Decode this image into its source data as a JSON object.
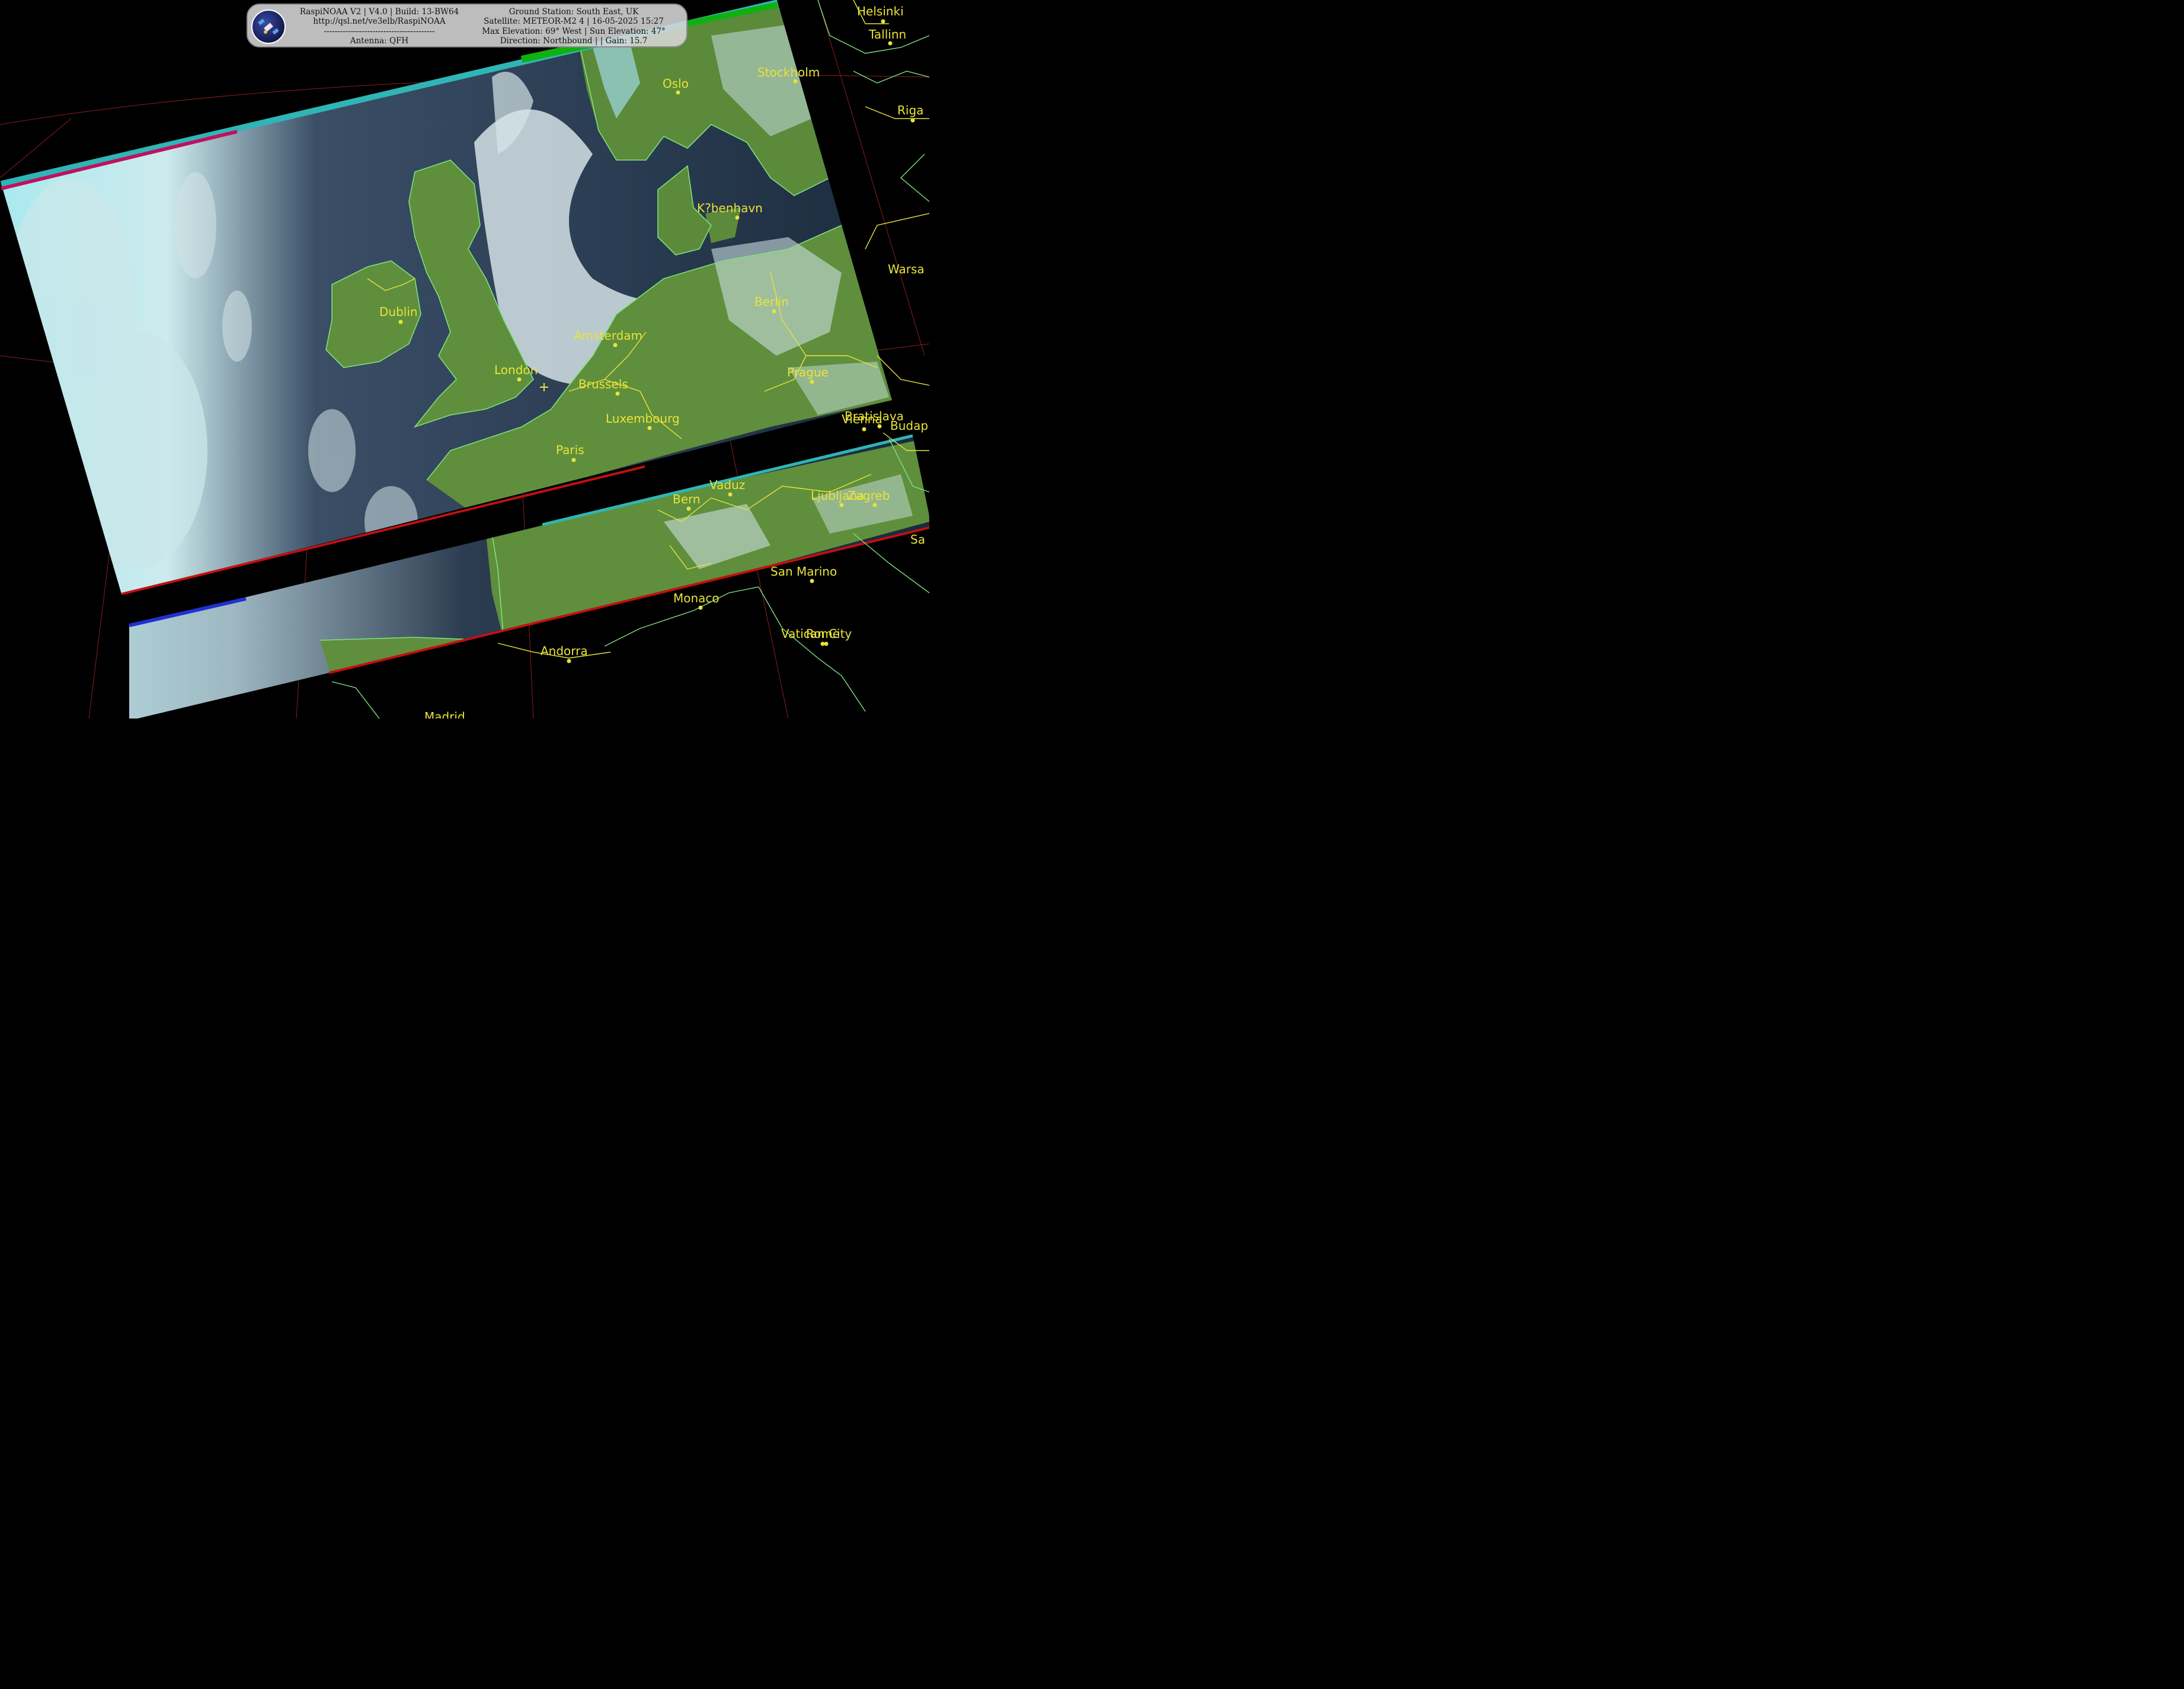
{
  "header": {
    "left_lines": [
      "RaspiNOAA V2 | V4.0 | Build: 13-BW64",
      "http://qsl.net/ve3elb/RaspiNOAA",
      "-----------------------------------------",
      "Antenna: QFH"
    ],
    "right_lines": [
      "Ground Station: South East, UK",
      "Satellite: METEOR-M2 4 | 16-05-2025 15:27",
      "Max Elevation: 69° West | Sun Elevation: 47°",
      "Direction: Northbound | | Gain: 15.7"
    ]
  },
  "logo": {
    "icon": "satellite-icon"
  },
  "colors": {
    "background": "#000000",
    "city_label": "#e8e33a",
    "coastline": "#7fe07f",
    "border": "#e8e33a",
    "graticule": "#8a1f1f",
    "land": "#5f8f3c",
    "sea": "#1c2b3c",
    "cloud": "#cfe6ea"
  },
  "cities": [
    {
      "name": "Helsinki"
    },
    {
      "name": "Tallinn"
    },
    {
      "name": "Stockholm"
    },
    {
      "name": "Oslo"
    },
    {
      "name": "Riga"
    },
    {
      "name": "K?benhavn"
    },
    {
      "name": "Warsa"
    },
    {
      "name": "Berlin"
    },
    {
      "name": "Dublin"
    },
    {
      "name": "Amsterdam"
    },
    {
      "name": "London"
    },
    {
      "name": "Brussels"
    },
    {
      "name": "Prague"
    },
    {
      "name": "Luxembourg"
    },
    {
      "name": "Bratislava"
    },
    {
      "name": "Vienna"
    },
    {
      "name": "Budap"
    },
    {
      "name": "Paris"
    },
    {
      "name": "Vaduz"
    },
    {
      "name": "Bern"
    },
    {
      "name": "Ljubljana"
    },
    {
      "name": "Zagreb"
    },
    {
      "name": "Sa"
    },
    {
      "name": "San Marino"
    },
    {
      "name": "Monaco"
    },
    {
      "name": "Vatican City"
    },
    {
      "name": "Rome"
    },
    {
      "name": "Andorra"
    },
    {
      "name": "Madrid"
    }
  ],
  "ground_station_marker": {
    "icon": "crosshair-icon"
  }
}
